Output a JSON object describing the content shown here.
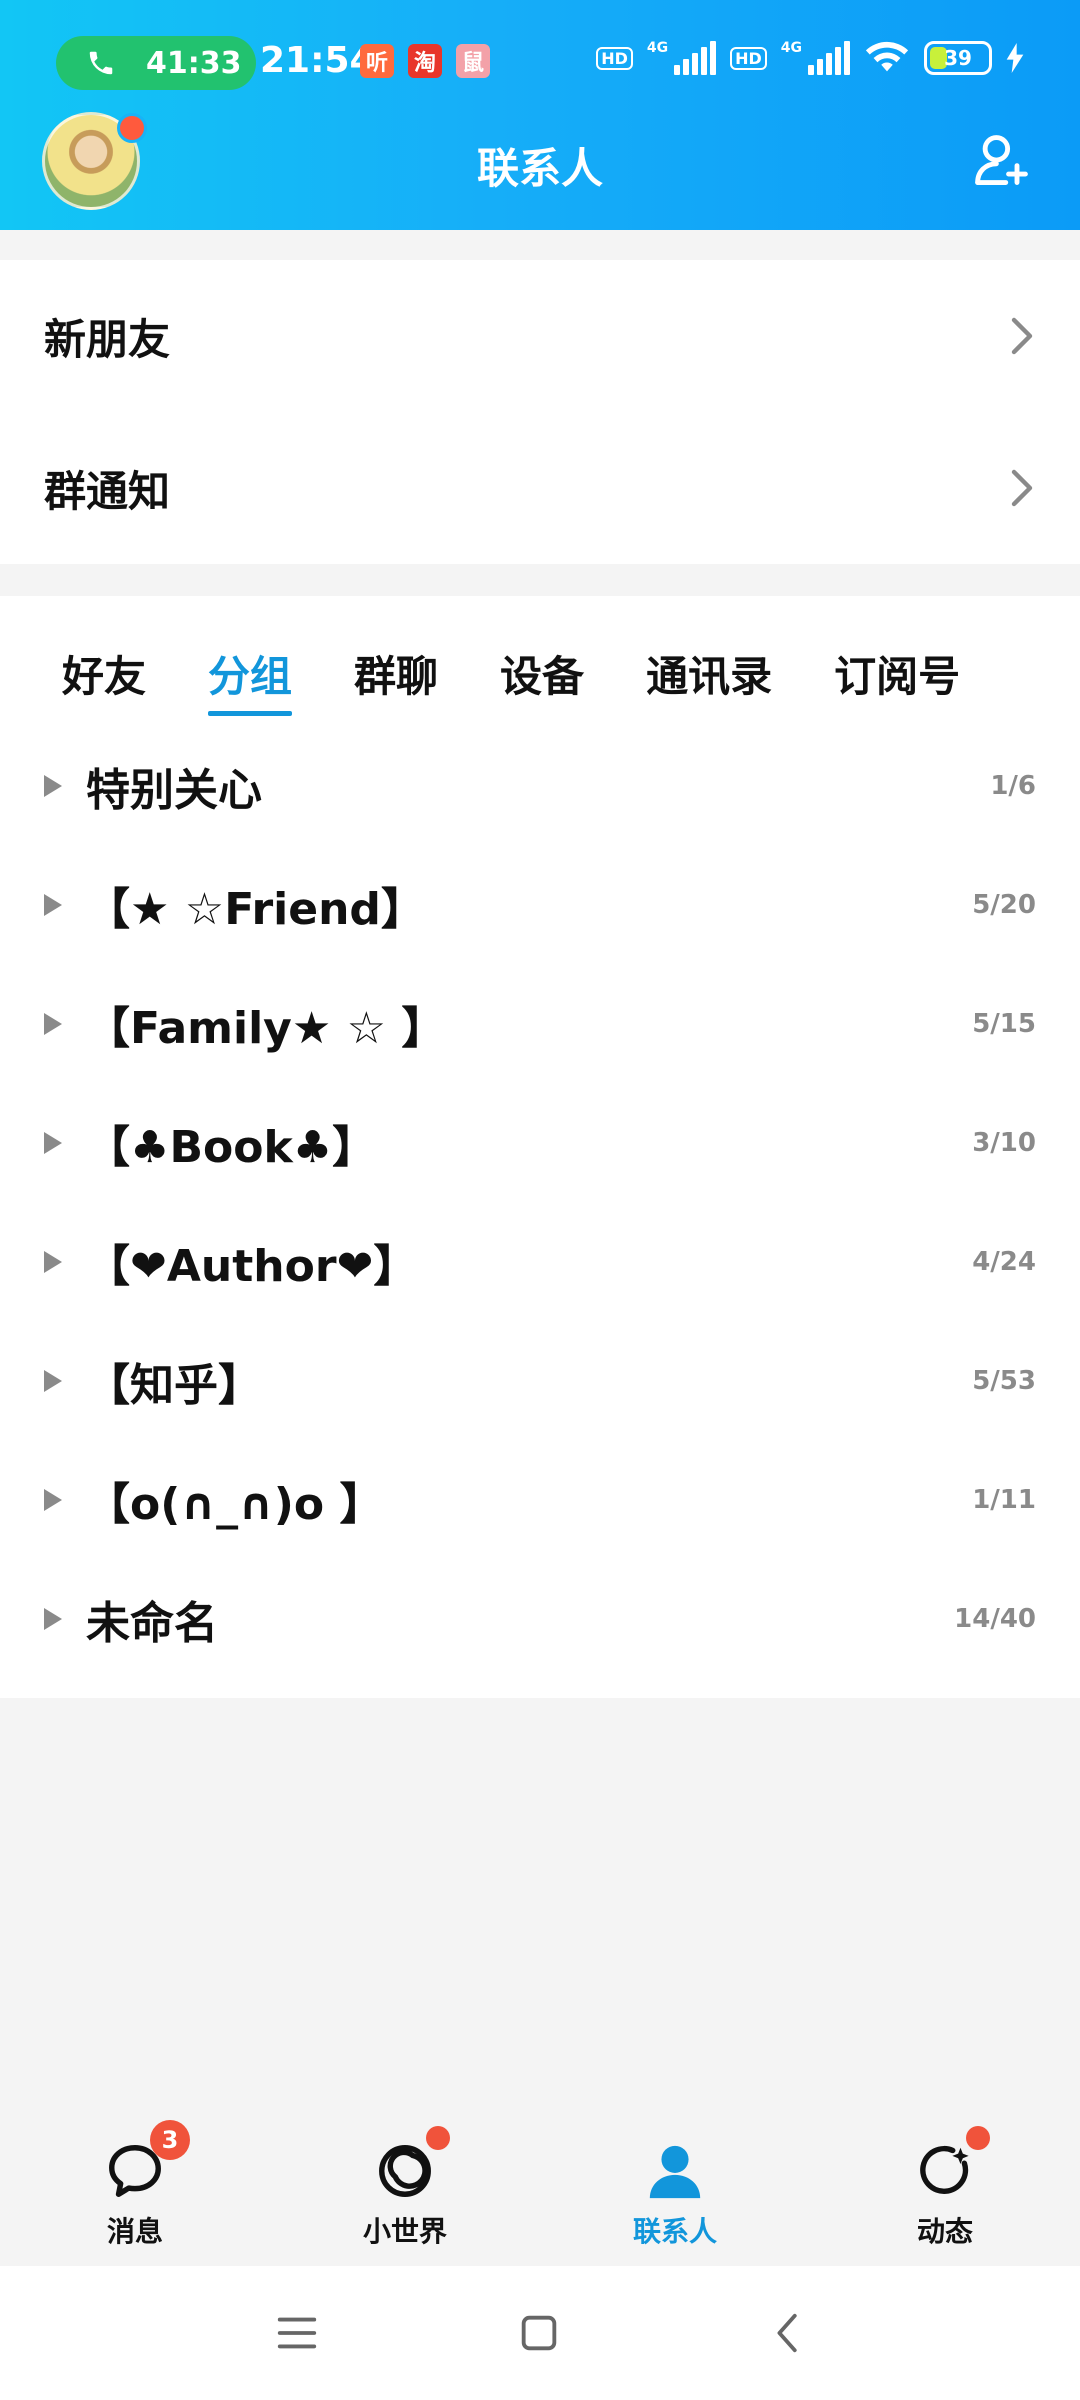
{
  "status_bar": {
    "call_duration": "41:33",
    "time": "21:54",
    "app_icons": [
      {
        "label": "听",
        "color": "#ff6a3d"
      },
      {
        "label": "淘",
        "color": "#e8362b"
      },
      {
        "label": "鼠",
        "color": "#f3a1a8"
      }
    ],
    "hd_label": "HD",
    "network_label": "4G",
    "battery_level": "39"
  },
  "header": {
    "title": "联系人"
  },
  "shortcuts": [
    {
      "label": "新朋友"
    },
    {
      "label": "群通知"
    }
  ],
  "tabs": [
    {
      "label": "好友",
      "active": false
    },
    {
      "label": "分组",
      "active": true
    },
    {
      "label": "群聊",
      "active": false
    },
    {
      "label": "设备",
      "active": false
    },
    {
      "label": "通讯录",
      "active": false
    },
    {
      "label": "订阅号",
      "active": false
    }
  ],
  "groups": [
    {
      "name": "特别关心",
      "count": "1/6"
    },
    {
      "name": "【★ ☆Friend】",
      "count": "5/20"
    },
    {
      "name": "【Family★ ☆ 】",
      "count": "5/15"
    },
    {
      "name": "【♣Book♣】",
      "count": "3/10"
    },
    {
      "name": "【❤Author❤】",
      "count": "4/24"
    },
    {
      "name": "【知乎】",
      "count": "5/53"
    },
    {
      "name": "【o(∩_∩)o 】",
      "count": "1/11"
    },
    {
      "name": "未命名",
      "count": "14/40"
    }
  ],
  "bottom_nav": [
    {
      "label": "消息",
      "icon": "chat-bubble-icon",
      "badge": "3",
      "active": false
    },
    {
      "label": "小世界",
      "icon": "small-world-icon",
      "badge": "",
      "active": false
    },
    {
      "label": "联系人",
      "icon": "contacts-person-icon",
      "badge": "",
      "active": true
    },
    {
      "label": "动态",
      "icon": "feed-star-icon",
      "badge": "",
      "active": false
    }
  ],
  "colors": {
    "accent": "#1296db",
    "header_gradient_start": "#12c6f5",
    "header_gradient_end": "#0b9bf7",
    "badge_red": "#f0533b",
    "call_green": "#22c26f"
  }
}
